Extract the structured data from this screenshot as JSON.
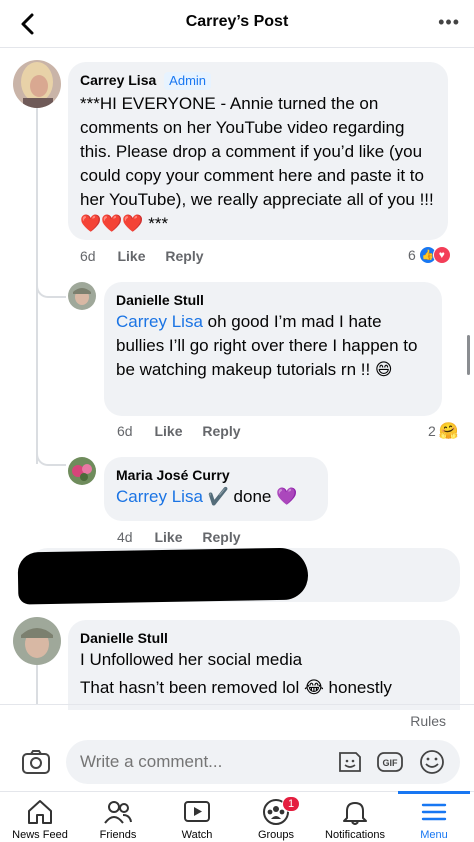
{
  "header": {
    "title": "Carrey’s Post"
  },
  "comments": [
    {
      "author": "Carrey Lisa",
      "badge": "Admin",
      "text": "***HI EVERYONE - Annie turned the on comments on her YouTube video regarding this. Please drop a comment if you’d like (you could copy your comment here and paste it to her YouTube), we really appreciate all of you !!! ❤️❤️❤️ ***",
      "time": "6d",
      "like": "Like",
      "reply": "Reply",
      "reaction_count": "6"
    },
    {
      "author": "Danielle Stull",
      "mention": "Carrey Lisa",
      "text": " oh good I’m mad I hate bullies I’ll go right over there I happen to be watching makeup tutorials rn !! 😄",
      "time": "6d",
      "like": "Like",
      "reply": "Reply",
      "reaction_count": "2"
    },
    {
      "author": "Maria José Curry",
      "mention": "Carrey Lisa",
      "text": " ✔️ done 💜",
      "time": "4d",
      "like": "Like",
      "reply": "Reply"
    },
    {
      "author": "Danielle Stull",
      "line1": "I Unfollowed her social media",
      "line2": "That hasn’t been removed lol 😂 honestly"
    }
  ],
  "rules": "Rules",
  "composer": {
    "placeholder": "Write a comment..."
  },
  "nav": {
    "items": [
      {
        "label": "News Feed"
      },
      {
        "label": "Friends"
      },
      {
        "label": "Watch"
      },
      {
        "label": "Groups",
        "badge": "1"
      },
      {
        "label": "Notifications"
      },
      {
        "label": "Menu"
      }
    ]
  },
  "colors": {
    "accent": "#1877f2",
    "bubble": "#f0f2f5",
    "muted": "#65676b"
  }
}
